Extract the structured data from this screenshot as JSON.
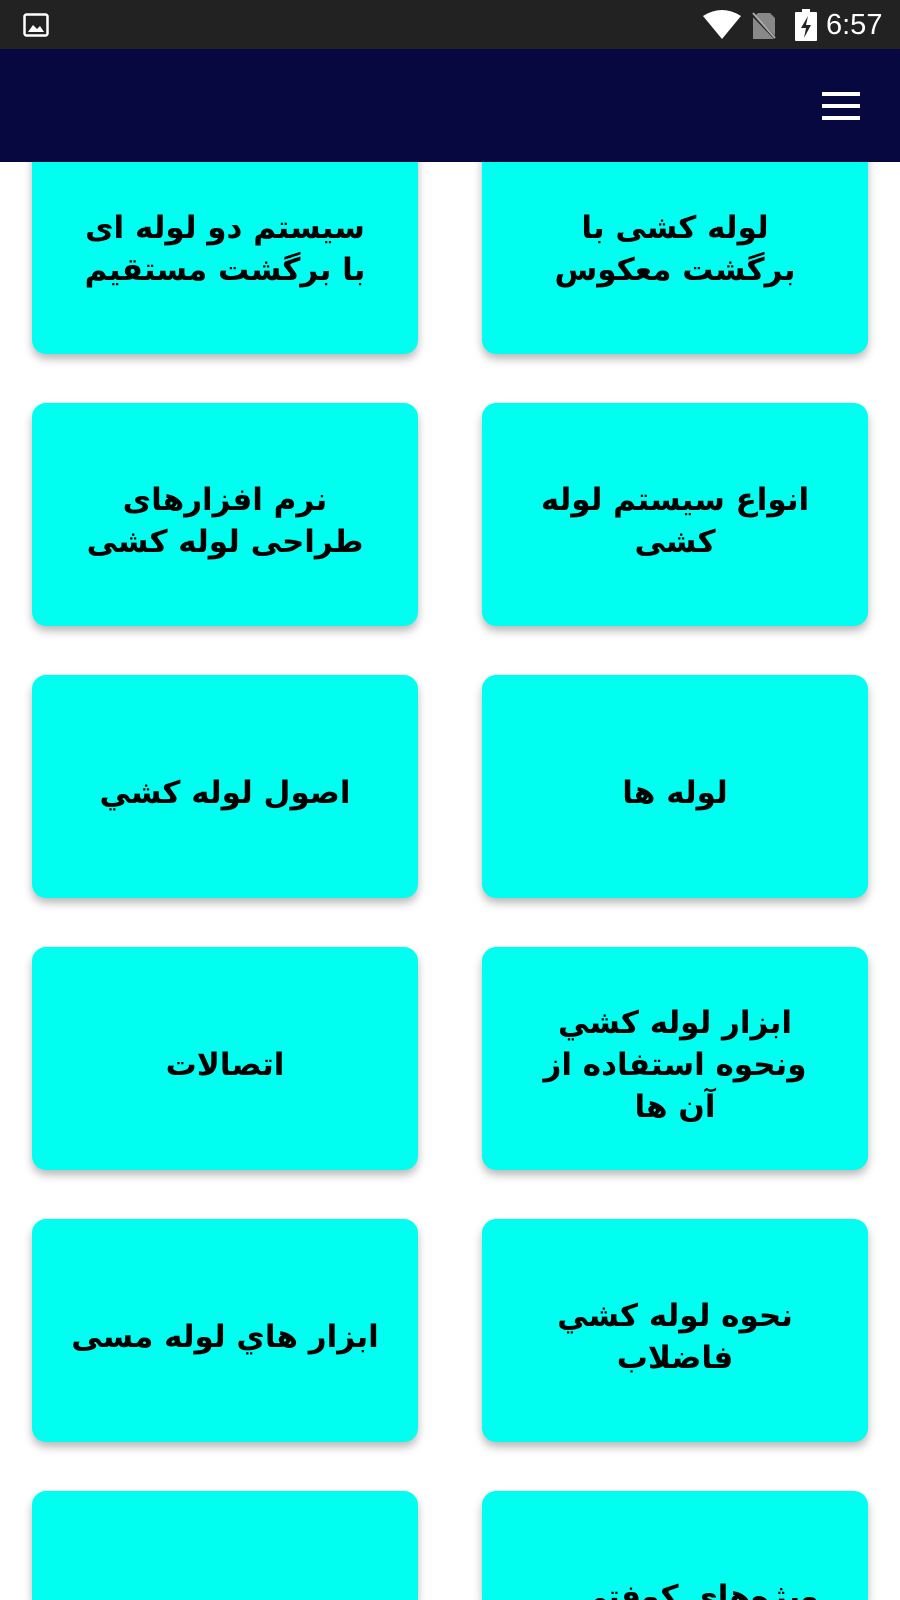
{
  "status_bar": {
    "time": "6:57",
    "icons": [
      "gallery-icon",
      "wifi-icon",
      "no-sim-icon",
      "battery-charging-icon"
    ]
  },
  "app_bar": {
    "menu_icon": "hamburger-menu-icon"
  },
  "colors": {
    "status_bar": "#222222",
    "app_bar": "#080840",
    "card_background": "#00fff0",
    "card_text": "#000000"
  },
  "cards": [
    {
      "label": "لوله کشی با برگشت معکوس"
    },
    {
      "label": "سیستم دو لوله ای با برگشت مستقیم"
    },
    {
      "label": "انواع سیستم لوله کشی"
    },
    {
      "label": "نرم افزارهای طراحی لوله کشی"
    },
    {
      "label": "لوله ها"
    },
    {
      "label": "اصول لوله كشي"
    },
    {
      "label": "ابزار لوله كشي ونحوه استفاده از آن ها"
    },
    {
      "label": "اتصالات"
    },
    {
      "label": "نحوه لوله كشي فاضلاب"
    },
    {
      "label": "ابزار هاي لوله مسی"
    },
    {
      "label": "ویژه‌های کوفتی ..."
    },
    {
      "label": ""
    }
  ]
}
